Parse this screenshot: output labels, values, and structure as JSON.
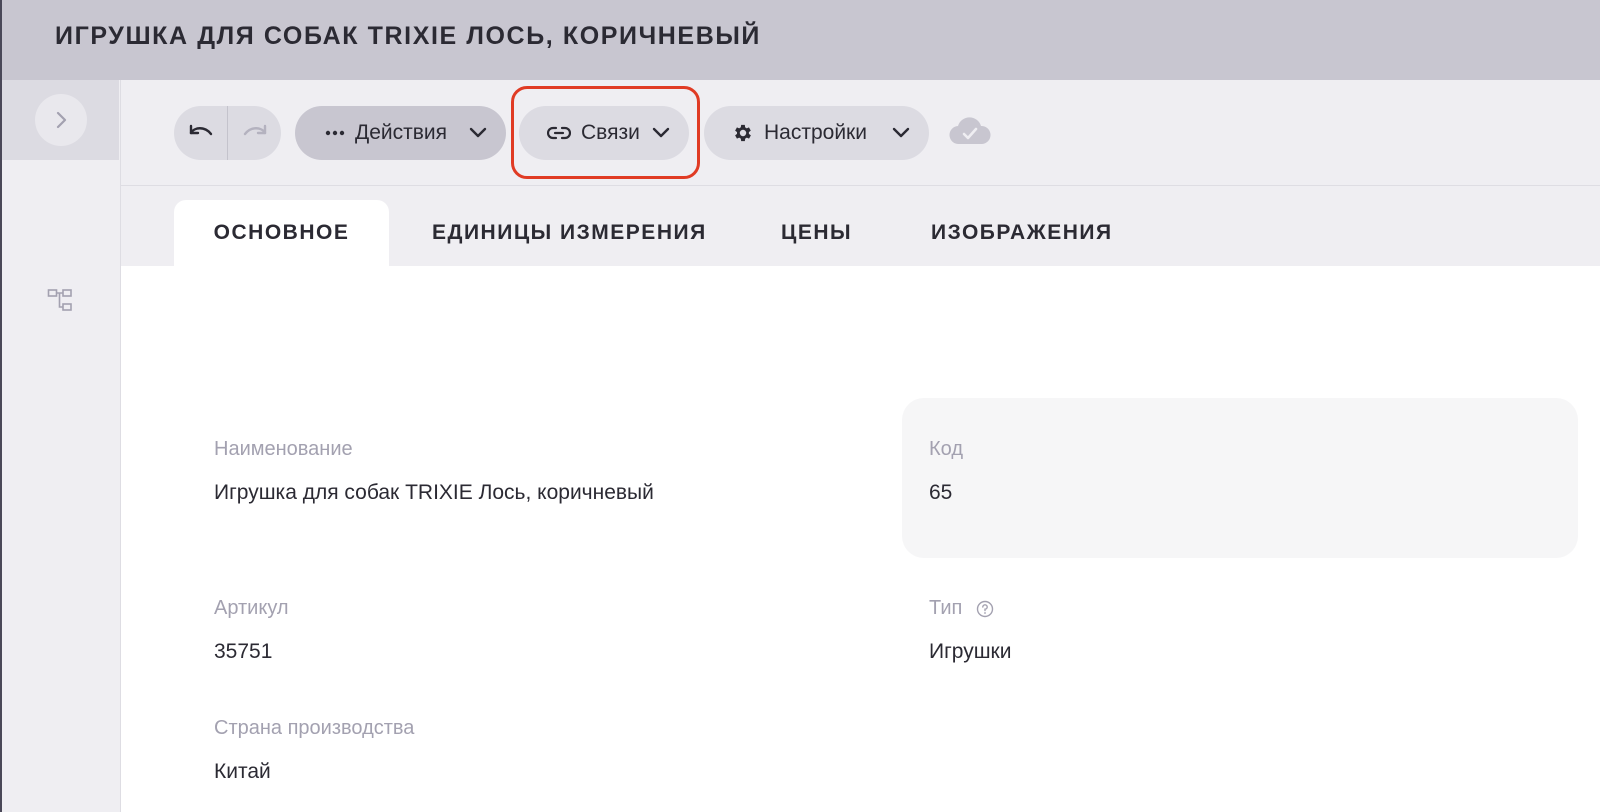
{
  "window": {
    "title": "ИГРУШКА ДЛЯ СОБАК TRIXIE ЛОСЬ, КОРИЧНЕВЫЙ"
  },
  "sidebar": {
    "expand_icon": "chevron-right-icon",
    "tree_icon": "tree-structure-icon"
  },
  "toolbar": {
    "undo_icon": "undo-icon",
    "redo_icon": "redo-icon",
    "actions_label": "Действия",
    "links_label": "Связи",
    "settings_label": "Настройки",
    "status_icon": "cloud-check-icon"
  },
  "tabs": [
    {
      "label": "ОСНОВНОЕ",
      "active": true
    },
    {
      "label": "ЕДИНИЦЫ ИЗМЕРЕНИЯ",
      "active": false
    },
    {
      "label": "ЦЕНЫ",
      "active": false
    },
    {
      "label": "ИЗОБРАЖЕНИЯ",
      "active": false
    }
  ],
  "fields": {
    "name": {
      "label": "Наименование",
      "value": "Игрушка для собак TRIXIE Лось, коричневый"
    },
    "code": {
      "label": "Код",
      "value": "65"
    },
    "article": {
      "label": "Артикул",
      "value": "35751"
    },
    "type": {
      "label": "Тип",
      "value": "Игрушки"
    },
    "country": {
      "label": "Страна производства",
      "value": "Китай"
    }
  },
  "colors": {
    "titlebar": "#c8c6d0",
    "toolbar": "#efeef2",
    "pill": "#dcdbe2",
    "highlight": "#e03b24",
    "text": "#2b2a33",
    "label": "#a3a1b0"
  }
}
